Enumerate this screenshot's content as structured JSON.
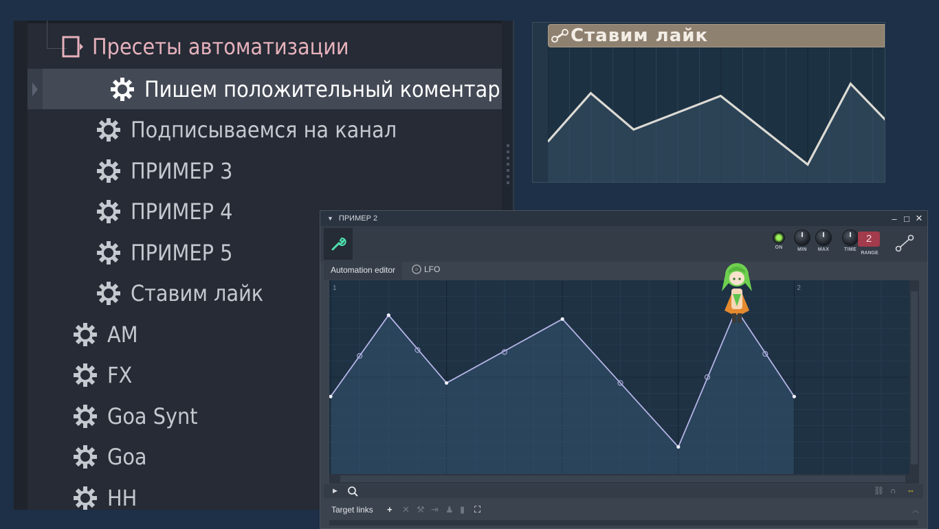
{
  "browser": {
    "folder_item": "Пресеты автоматизации",
    "items": [
      {
        "label": "Пишем положительный коментарий",
        "selected": true,
        "indent": 2
      },
      {
        "label": "Подписываемся на канал",
        "indent": 1
      },
      {
        "label": "ПРИМЕР 3",
        "indent": 1
      },
      {
        "label": "ПРИМЕР 4",
        "indent": 1
      },
      {
        "label": "ПРИМЕР 5",
        "indent": 1
      },
      {
        "label": "Ставим лайк",
        "indent": 1
      },
      {
        "label": "AM",
        "indent": 0
      },
      {
        "label": "FX",
        "indent": 0
      },
      {
        "label": "Goa Synt",
        "indent": 0
      },
      {
        "label": "Goa",
        "indent": 0
      },
      {
        "label": "HH",
        "indent": 0
      }
    ]
  },
  "playlist_clip": {
    "title": "Ставим лайк",
    "header_color": "#8f8170"
  },
  "window": {
    "title": "ПРИМЕР 2",
    "controls": {
      "minimize": "–",
      "maximize": "□",
      "close": "✕"
    },
    "knobs": {
      "on_label": "ON",
      "min_label": "MIN",
      "max_label": "MAX",
      "time_label": "TIME",
      "range_label": "RANGE",
      "range_value": "2"
    },
    "tabs": {
      "editor": "Automation editor",
      "lfo": "LFO"
    },
    "bar_markers": [
      "1",
      "2"
    ],
    "target_links_label": "Target links",
    "accent_color": "#9cf05a",
    "range_color": "#a23b4c"
  },
  "chart_data": {
    "type": "line",
    "points": [
      {
        "x": 0,
        "y": 0.4
      },
      {
        "x": 0.5,
        "y": 0.82
      },
      {
        "x": 1.0,
        "y": 0.47
      },
      {
        "x": 2.0,
        "y": 0.8
      },
      {
        "x": 3.0,
        "y": 0.14
      },
      {
        "x": 3.5,
        "y": 0.85
      },
      {
        "x": 4.0,
        "y": 0.4
      }
    ],
    "tension_handles": [
      {
        "x": 0.25,
        "y": 0.61
      },
      {
        "x": 0.75,
        "y": 0.64
      },
      {
        "x": 1.5,
        "y": 0.63
      },
      {
        "x": 2.5,
        "y": 0.47
      },
      {
        "x": 3.25,
        "y": 0.5
      },
      {
        "x": 3.75,
        "y": 0.62
      }
    ],
    "clip_points": [
      {
        "x": 0,
        "y": 0.3
      },
      {
        "x": 0.33,
        "y": 0.66
      },
      {
        "x": 0.66,
        "y": 0.39
      },
      {
        "x": 1.33,
        "y": 0.64
      },
      {
        "x": 2.0,
        "y": 0.13
      },
      {
        "x": 2.33,
        "y": 0.73
      },
      {
        "x": 2.66,
        "y": 0.4
      }
    ]
  }
}
